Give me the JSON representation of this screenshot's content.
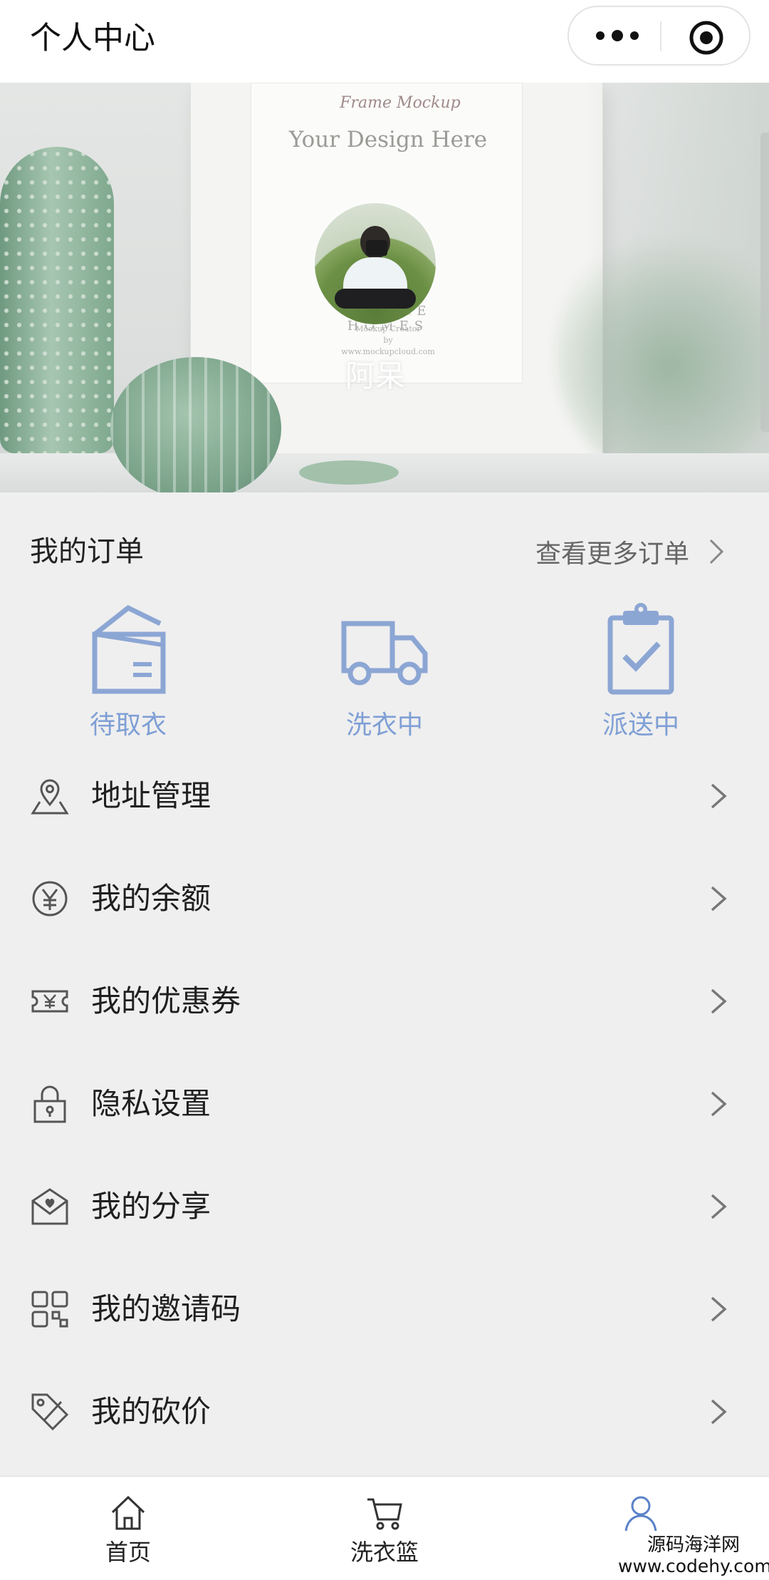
{
  "header": {
    "title": "个人中心"
  },
  "banner": {
    "frame_script": "Frame Mockup",
    "frame_title": "Your Design Here",
    "frame_brand": "SIMPLE HOMES",
    "frame_small_1": "Mockup Creator",
    "frame_small_2": "by",
    "frame_small_3": "www.mockupcloud.com"
  },
  "user": {
    "name": "阿呆"
  },
  "orders": {
    "title": "我的订单",
    "more_label": "查看更多订单",
    "items": [
      {
        "label": "待取衣",
        "icon": "wardrobe-icon"
      },
      {
        "label": "洗衣中",
        "icon": "truck-icon"
      },
      {
        "label": "派送中",
        "icon": "clipboard-check-icon"
      }
    ],
    "accent": "#7f9fd5"
  },
  "menu": [
    {
      "label": "地址管理",
      "icon": "location-icon"
    },
    {
      "label": "我的余额",
      "icon": "yen-circle-icon"
    },
    {
      "label": "我的优惠券",
      "icon": "coupon-icon"
    },
    {
      "label": "隐私设置",
      "icon": "lock-icon"
    },
    {
      "label": "我的分享",
      "icon": "share-envelope-icon"
    },
    {
      "label": "我的邀请码",
      "icon": "qr-code-icon"
    },
    {
      "label": "我的砍价",
      "icon": "price-tag-icon"
    }
  ],
  "tabbar": [
    {
      "label": "首页",
      "icon": "home-icon"
    },
    {
      "label": "洗衣篮",
      "icon": "cart-icon"
    },
    {
      "label": "",
      "icon": "user-icon",
      "active_color": "#5a82c8"
    }
  ],
  "watermark": {
    "line1": "源码海洋网",
    "line2": "www.codehy.com"
  }
}
